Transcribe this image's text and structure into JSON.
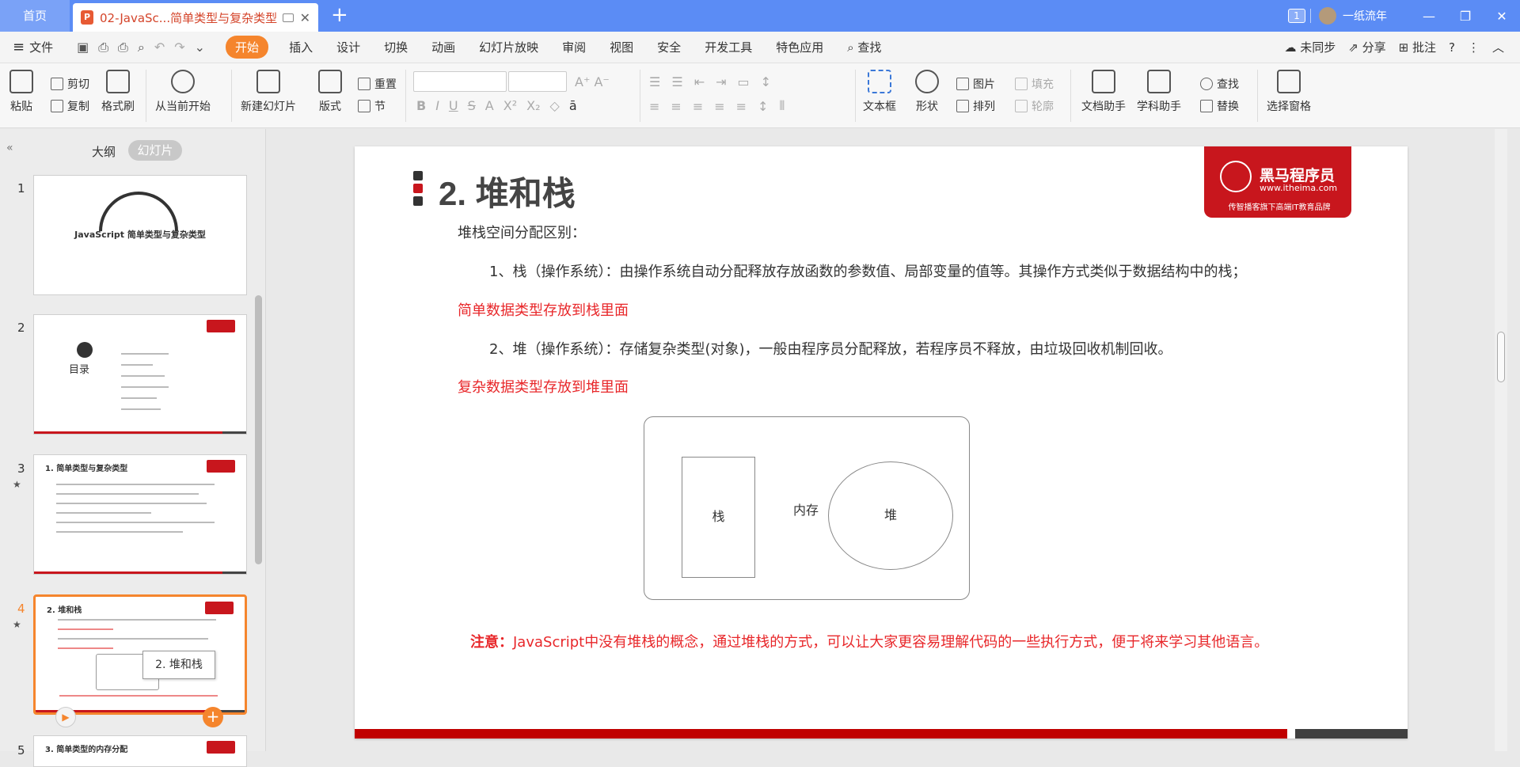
{
  "titlebar": {
    "home_tab": "首页",
    "doc_tab": "02-JavaSc...简单类型与复杂类型",
    "badge": "1",
    "user": "一纸流年"
  },
  "menu": {
    "file": "文件",
    "start": "开始",
    "items": [
      "插入",
      "设计",
      "切换",
      "动画",
      "幻灯片放映",
      "审阅",
      "视图",
      "安全",
      "开发工具",
      "特色应用"
    ],
    "search": "查找",
    "sync": "未同步",
    "share": "分享",
    "annotate": "批注"
  },
  "ribbon": {
    "paste": "粘贴",
    "cut": "剪切",
    "copy": "复制",
    "format_painter": "格式刷",
    "from_current": "从当前开始",
    "new_slide": "新建幻灯片",
    "layout": "版式",
    "reset": "重置",
    "section": "节",
    "textbox": "文本框",
    "shape": "形状",
    "picture": "图片",
    "arrange": "排列",
    "fill": "填充",
    "outline": "轮廓",
    "doc_helper": "文档助手",
    "subject_helper": "学科助手",
    "find": "查找",
    "replace": "替换",
    "select_pane": "选择窗格"
  },
  "left_panel": {
    "outline_tab": "大纲",
    "slides_tab": "幻灯片",
    "thumbs": [
      {
        "num": "1",
        "title": "JavaScript 简单类型与复杂类型"
      },
      {
        "num": "2",
        "title": "目录"
      },
      {
        "num": "3",
        "title": "1. 简单类型与复杂类型"
      },
      {
        "num": "4",
        "title": "2. 堆和栈"
      },
      {
        "num": "5",
        "title": "3. 简单类型的内存分配"
      }
    ],
    "tooltip": "2. 堆和栈"
  },
  "slide": {
    "title": "2. 堆和栈",
    "logo_name": "黑马程序员",
    "logo_url": "www.itheima.com",
    "logo_slogan": "传智播客旗下高端IT教育品牌",
    "intro": "堆栈空间分配区别：",
    "p1": "1、栈（操作系统）：由操作系统自动分配释放存放函数的参数值、局部变量的值等。其操作方式类似于数据结构中的栈；",
    "r1": "简单数据类型存放到栈里面",
    "p2": "2、堆（操作系统）：存储复杂类型(对象)，一般由程序员分配释放，若程序员不释放，由垃圾回收机制回收。",
    "r2": "复杂数据类型存放到堆里面",
    "diagram": {
      "stack": "栈",
      "memory": "内存",
      "heap": "堆"
    },
    "note_label": "注意：",
    "note_text": "JavaScript中没有堆栈的概念，通过堆栈的方式，可以让大家更容易理解代码的一些执行方式，便于将来学习其他语言。"
  },
  "colors": {
    "accent": "#f5852d",
    "titlebar": "#5b8cf5",
    "brand_red": "#c8161d",
    "text_red": "#e8272a"
  }
}
